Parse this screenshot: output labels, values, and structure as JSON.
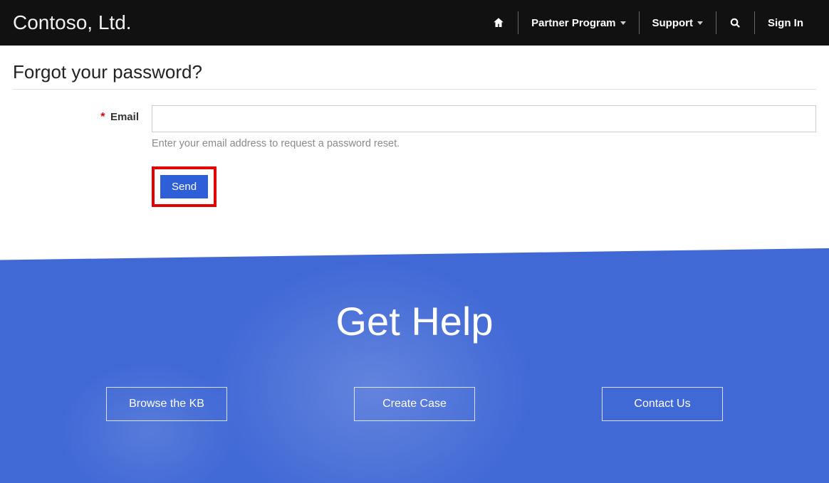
{
  "nav": {
    "brand": "Contoso, Ltd.",
    "partner_label": "Partner Program",
    "support_label": "Support",
    "signin_label": "Sign In"
  },
  "main": {
    "title": "Forgot your password?",
    "email_label": "Email",
    "email_help": "Enter your email address to request a password reset.",
    "send_label": "Send"
  },
  "hero": {
    "title": "Get Help",
    "buttons": {
      "kb": "Browse the KB",
      "case": "Create Case",
      "contact": "Contact Us"
    }
  }
}
